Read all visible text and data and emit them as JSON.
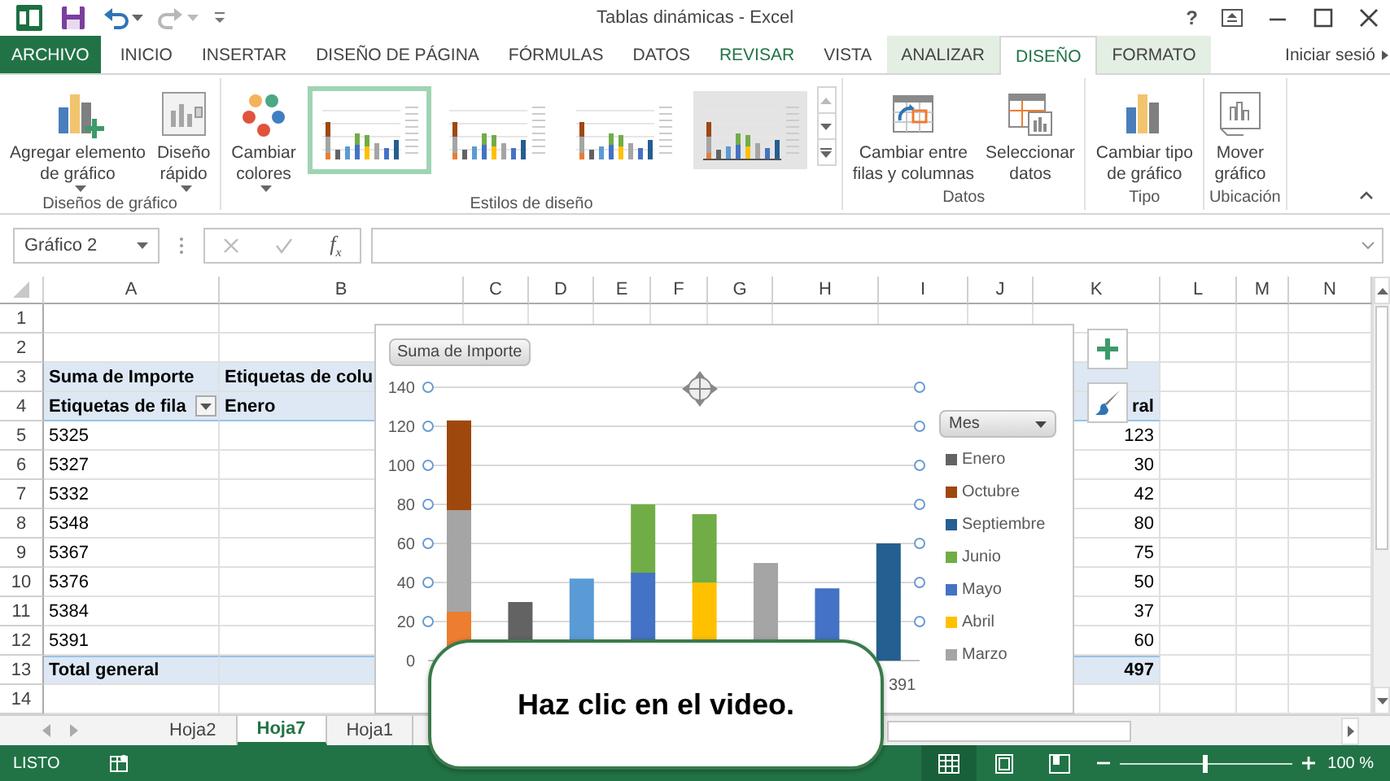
{
  "title_bar": {
    "title": "Tablas dinámicas - Excel",
    "help": "?",
    "redo_disabled": true
  },
  "tabs": [
    {
      "label": "ARCHIVO",
      "kind": "file",
      "selected": false
    },
    {
      "label": "INICIO",
      "kind": "plain",
      "selected": false
    },
    {
      "label": "INSERTAR",
      "kind": "plain",
      "selected": false
    },
    {
      "label": "DISEÑO DE PÁGINA",
      "kind": "plain",
      "selected": false
    },
    {
      "label": "FÓRMULAS",
      "kind": "plain",
      "selected": false
    },
    {
      "label": "DATOS",
      "kind": "plain",
      "selected": false
    },
    {
      "label": "REVISAR",
      "kind": "accent",
      "selected": false
    },
    {
      "label": "VISTA",
      "kind": "plain",
      "selected": false
    },
    {
      "label": "ANALIZAR",
      "kind": "contextual",
      "selected": false
    },
    {
      "label": "DISEÑO",
      "kind": "contextual",
      "selected": true
    },
    {
      "label": "FORMATO",
      "kind": "contextual",
      "selected": false
    },
    {
      "label": "Iniciar sesió",
      "kind": "account",
      "selected": false
    }
  ],
  "ribbon": {
    "groups": [
      {
        "label": "Diseños de gráfico",
        "items": [
          {
            "kind": "button",
            "label": "Agregar elemento\nde gráfico",
            "dropdown": true
          },
          {
            "kind": "button",
            "label": "Diseño\nrápido",
            "dropdown": true
          }
        ]
      },
      {
        "label": "Estilos de diseño",
        "items": [
          {
            "kind": "button",
            "label": "Cambiar\ncolores",
            "dropdown": true
          },
          {
            "kind": "gallery",
            "styles": [
              {
                "selected": true,
                "shaded": false
              },
              {
                "selected": false,
                "shaded": false
              },
              {
                "selected": false,
                "shaded": false
              },
              {
                "selected": false,
                "shaded": true
              }
            ]
          }
        ]
      },
      {
        "label": "Datos",
        "items": [
          {
            "kind": "button",
            "label": "Cambiar entre\nfilas y columnas",
            "dropdown": false
          },
          {
            "kind": "button",
            "label": "Seleccionar\ndatos",
            "dropdown": false
          }
        ]
      },
      {
        "label": "Tipo",
        "items": [
          {
            "kind": "button",
            "label": "Cambiar tipo\nde gráfico",
            "dropdown": false
          }
        ]
      },
      {
        "label": "Ubicación",
        "items": [
          {
            "kind": "button",
            "label": "Mover\ngráfico",
            "dropdown": false
          }
        ]
      }
    ]
  },
  "formula_bar": {
    "name_box": "Gráfico 2",
    "function_label": "f$_{x}$"
  },
  "sheet": {
    "columns": [
      "A",
      "B",
      "C",
      "D",
      "E",
      "F",
      "G",
      "H",
      "I",
      "J",
      "K",
      "L",
      "M",
      "N"
    ],
    "rows": [
      {
        "number": "1",
        "kind": "empty"
      },
      {
        "number": "2",
        "kind": "empty"
      },
      {
        "number": "3",
        "kind": "header",
        "cells": {
          "A": "Suma de Importe",
          "B": "Etiquetas de colu"
        }
      },
      {
        "number": "4",
        "kind": "header",
        "cells": {
          "A": "Etiquetas de fila",
          "B": "Enero",
          "K": "ral"
        },
        "filter_button": true
      },
      {
        "number": "5",
        "kind": "data",
        "cells": {
          "A": "5325",
          "K": "123"
        }
      },
      {
        "number": "6",
        "kind": "data",
        "cells": {
          "A": "5327",
          "K": "30"
        }
      },
      {
        "number": "7",
        "kind": "data",
        "cells": {
          "A": "5332",
          "K": "42"
        }
      },
      {
        "number": "8",
        "kind": "data",
        "cells": {
          "A": "5348",
          "K": "80"
        }
      },
      {
        "number": "9",
        "kind": "data",
        "cells": {
          "A": "5367",
          "K": "75"
        }
      },
      {
        "number": "10",
        "kind": "data",
        "cells": {
          "A": "5376",
          "K": "50"
        }
      },
      {
        "number": "11",
        "kind": "data",
        "cells": {
          "A": "5384",
          "K": "37"
        }
      },
      {
        "number": "12",
        "kind": "data",
        "cells": {
          "A": "5391",
          "K": "60"
        }
      },
      {
        "number": "13",
        "kind": "total",
        "cells": {
          "A": "Total general",
          "K": "497"
        }
      },
      {
        "number": "14",
        "kind": "empty"
      }
    ]
  },
  "chart": {
    "field_button": "Suma de Importe",
    "legend_title": "Mes",
    "visible_category_label": "391",
    "chart_data": {
      "type": "bar",
      "stacked": true,
      "grid": true,
      "legend": "right",
      "ylim": [
        0,
        140
      ],
      "yticks": [
        {
          "value": 0,
          "label": "0"
        },
        {
          "value": 20,
          "label": "20"
        },
        {
          "value": 40,
          "label": "40"
        },
        {
          "value": 60,
          "label": "60"
        },
        {
          "value": 80,
          "label": "80"
        },
        {
          "value": 100,
          "label": "100"
        },
        {
          "value": 120,
          "label": "120"
        },
        {
          "value": 140,
          "label": "140"
        }
      ],
      "series": [
        {
          "color": "#ed7d31",
          "values": [
            25,
            null,
            null,
            null,
            null,
            null,
            null,
            null
          ]
        },
        {
          "color": "#5b9bd5",
          "values": [
            null,
            null,
            42,
            null,
            null,
            null,
            null,
            null
          ]
        },
        {
          "name": "Marzo",
          "color": "#a5a5a5",
          "values": [
            52,
            null,
            null,
            null,
            null,
            50,
            null,
            null
          ]
        },
        {
          "name": "Abril",
          "color": "#ffc000",
          "values": [
            null,
            null,
            null,
            null,
            40,
            null,
            null,
            null
          ]
        },
        {
          "name": "Mayo",
          "color": "#4472c4",
          "values": [
            null,
            null,
            null,
            45,
            null,
            null,
            37,
            null
          ]
        },
        {
          "name": "Junio",
          "color": "#70ad47",
          "values": [
            null,
            null,
            null,
            35,
            35,
            null,
            null,
            null
          ]
        },
        {
          "name": "Septiembre",
          "color": "#255e91",
          "values": [
            null,
            null,
            null,
            null,
            null,
            null,
            null,
            60
          ]
        },
        {
          "name": "Octubre",
          "color": "#9e480e",
          "values": [
            46,
            null,
            null,
            null,
            null,
            null,
            null,
            null
          ]
        },
        {
          "name": "Enero",
          "color": "#636363",
          "values": [
            null,
            30,
            null,
            null,
            null,
            null,
            null,
            null
          ]
        }
      ]
    }
  },
  "sheet_tabs": [
    {
      "label": "Hoja2",
      "selected": false
    },
    {
      "label": "Hoja7",
      "selected": true
    },
    {
      "label": "Hoja1",
      "selected": false
    }
  ],
  "status_bar": {
    "status": "LISTO",
    "views": [
      {
        "selected": true
      },
      {
        "selected": false
      },
      {
        "selected": false
      }
    ],
    "zoom": {
      "level": 0.5,
      "reading": "100 %"
    }
  },
  "callout": "Haz clic en el video."
}
